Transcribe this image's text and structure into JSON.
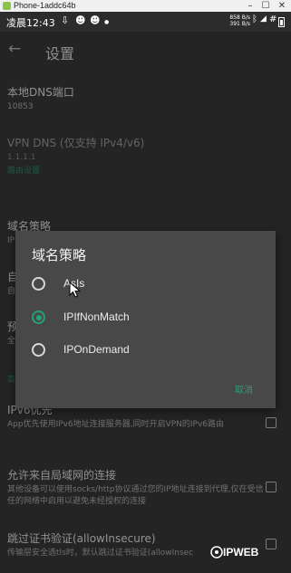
{
  "window": {
    "title": "Phone-1addc64b"
  },
  "status_bar": {
    "time": "凌晨12:43",
    "speed_up": "858 B/s",
    "speed_down": "391 B/s",
    "icons": [
      "download-icon",
      "cat-icon",
      "cat-icon",
      "dot",
      "bluetooth-icon",
      "check-box-icon",
      "wifi-icon",
      "signal-icon",
      "hash-icon",
      "battery-icon"
    ]
  },
  "appbar": {
    "title": "设置"
  },
  "settings": {
    "local_dns_port": {
      "title": "本地DNS端口",
      "value": "10853"
    },
    "vpn_dns": {
      "title": "VPN DNS (仅支持 IPv4/v6)",
      "value": "1.1.1.1"
    },
    "category_routing": "路由设置",
    "domain_strategy": {
      "title": "域名策略",
      "value": "IP"
    },
    "item_a": {
      "title": "自",
      "value": "自"
    },
    "item_b": {
      "title": "预",
      "value": "全"
    },
    "category_advanced": "高",
    "ipv6_preferred": {
      "title": "IPv6优先",
      "summary": "App优先使用IPv6地址连接服务器,同时开启VPN的IPv6路由"
    },
    "allow_lan": {
      "title": "允许来自局域网的连接",
      "summary": "其他设备可以使用socks/http协议通过您的IP地址连接到代理,仅在受信任的网络中启用以避免未经授权的连接"
    },
    "allow_insecure": {
      "title": "跳过证书验证(allowInsecure)",
      "summary": "传输层安全选tls时，默认跳过证书验证(allowInsec"
    }
  },
  "dialog": {
    "title": "域名策略",
    "options": [
      "AsIs",
      "IPIfNonMatch",
      "IPOnDemand"
    ],
    "selected": "IPIfNonMatch",
    "cancel": "取消"
  },
  "watermark": "IPWEB",
  "colors": {
    "accent": "#26a07a",
    "background": "#3a3a3a",
    "dialog": "#484848"
  }
}
